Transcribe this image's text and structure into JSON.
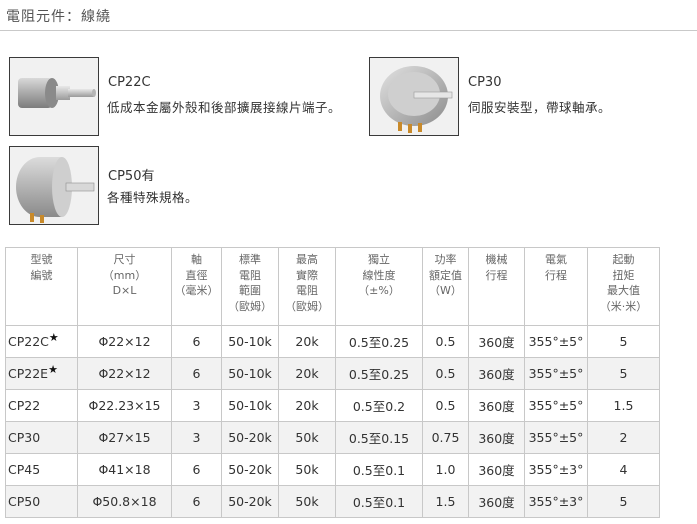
{
  "page": {
    "title": "電阻元件：線繞"
  },
  "products": [
    {
      "name": "CP22C",
      "description": "低成本金屬外殼和後部擴展接線片端子。",
      "image_icon": "potentiometer-image"
    },
    {
      "name": "CP30",
      "description": "伺服安裝型，帶球軸承。",
      "image_icon": "potentiometer-image"
    },
    {
      "name": "CP50有",
      "description": "各種特殊規格。",
      "image_icon": "potentiometer-image"
    }
  ],
  "table": {
    "headers": [
      [
        "型號",
        "編號"
      ],
      [
        "尺寸",
        "（mm）",
        "D×L"
      ],
      [
        "軸",
        "直徑",
        "（毫米）"
      ],
      [
        "標準",
        "電阻",
        "範圍",
        "（歐姆）"
      ],
      [
        "最高",
        "實際",
        "電阻",
        "（歐姆）"
      ],
      [
        "獨立",
        "線性度",
        "（±%）"
      ],
      [
        "功率",
        "額定值",
        "（W）"
      ],
      [
        "機械",
        "行程"
      ],
      [
        "電氣",
        "行程"
      ],
      [
        "起動",
        "扭矩",
        "最大值",
        "（米·米）"
      ]
    ],
    "rows": [
      {
        "model": "CP22C",
        "star": "★",
        "size": "Φ22×12",
        "shaft": "6",
        "std": "50-10k",
        "max": "20k",
        "lin_a": "0.5至",
        "lin_b": "0.25",
        "power": "0.5",
        "mech": "360度",
        "elec": "355°±5°",
        "torque": "5"
      },
      {
        "model": "CP22E",
        "star": "★",
        "size": "Φ22×12",
        "shaft": "6",
        "std": "50-10k",
        "max": "20k",
        "lin_a": "0.5至",
        "lin_b": "0.25",
        "power": "0.5",
        "mech": "360度",
        "elec": "355°±5°",
        "torque": "5"
      },
      {
        "model": "CP22",
        "star": "",
        "size": "Φ22.23×15",
        "shaft": "3",
        "std": "50-10k",
        "max": "20k",
        "lin_a": "0.5至",
        "lin_b": "0.2",
        "power": "0.5",
        "mech": "360度",
        "elec": "355°±5°",
        "torque": "1.5"
      },
      {
        "model": "CP30",
        "star": "",
        "size": "Φ27×15",
        "shaft": "3",
        "std": "50-20k",
        "max": "50k",
        "lin_a": "0.5至",
        "lin_b": "0.15",
        "power": "0.75",
        "mech": "360度",
        "elec": "355°±5°",
        "torque": "2"
      },
      {
        "model": "CP45",
        "star": "",
        "size": "Φ41×18",
        "shaft": "6",
        "std": "50-20k",
        "max": "50k",
        "lin_a": "0.5至",
        "lin_b": "0.1",
        "power": "1.0",
        "mech": "360度",
        "elec": "355°±3°",
        "torque": "4"
      },
      {
        "model": "CP50",
        "star": "",
        "size": "Φ50.8×18",
        "shaft": "6",
        "std": "50-20k",
        "max": "50k",
        "lin_a": "0.5至",
        "lin_b": "0.1",
        "power": "1.5",
        "mech": "360度",
        "elec": "355°±3°",
        "torque": "5"
      }
    ]
  }
}
